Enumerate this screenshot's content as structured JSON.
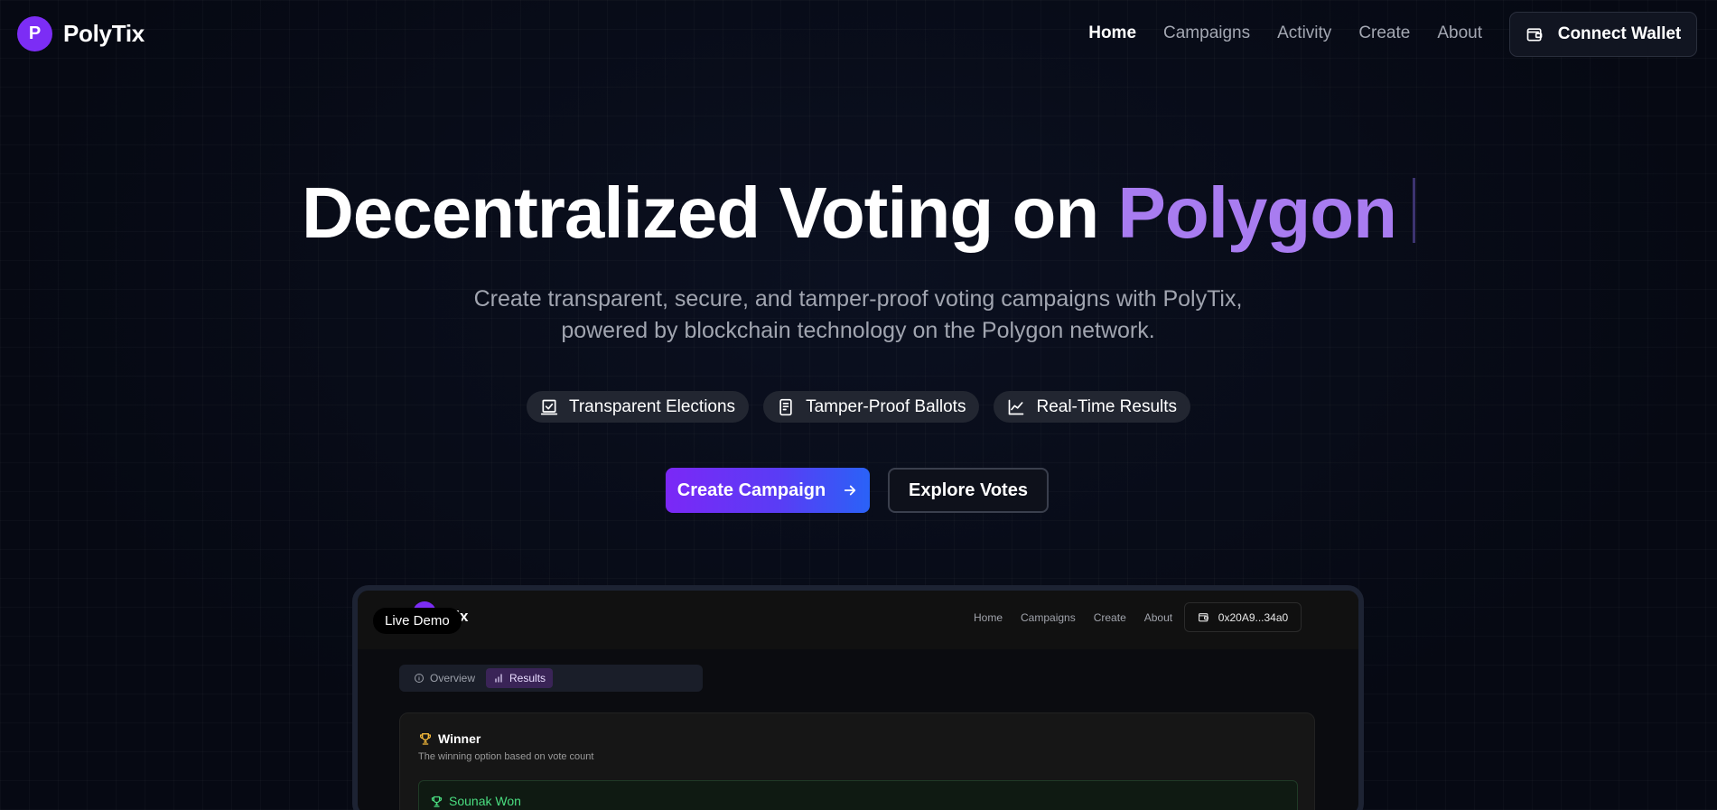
{
  "brand": {
    "logo_letter": "P",
    "name": "PolyTix"
  },
  "nav": {
    "links": [
      "Home",
      "Campaigns",
      "Activity",
      "Create",
      "About"
    ],
    "active": "Home",
    "connect_label": "Connect Wallet"
  },
  "hero": {
    "title_main": "Decentralized Voting on ",
    "title_accent": "Polygon",
    "subtitle": "Create transparent, secure, and tamper-proof voting campaigns with PolyTix, powered by blockchain technology on the Polygon network.",
    "features": [
      {
        "icon": "ballot-check-icon",
        "label": "Transparent Elections"
      },
      {
        "icon": "receipt-icon",
        "label": "Tamper-Proof Ballots"
      },
      {
        "icon": "line-chart-icon",
        "label": "Real-Time Results"
      }
    ],
    "primary_cta": "Create Campaign",
    "secondary_cta": "Explore Votes"
  },
  "demo": {
    "badge": "Live Demo",
    "brand_partial": "lyTix",
    "links": [
      "Home",
      "Campaigns",
      "Create",
      "About"
    ],
    "wallet_address": "0x20A9...34a0",
    "tabs": [
      "Overview",
      "Results"
    ],
    "active_tab": "Results",
    "card_title": "Winner",
    "card_subtitle": "The winning option based on vote count",
    "winner_label": "Sounak Won"
  },
  "colors": {
    "accent": "#a87cf0",
    "brand_purple": "#7c2df5",
    "gradient_end": "#2a62f7",
    "winner_green": "#4ade80"
  }
}
